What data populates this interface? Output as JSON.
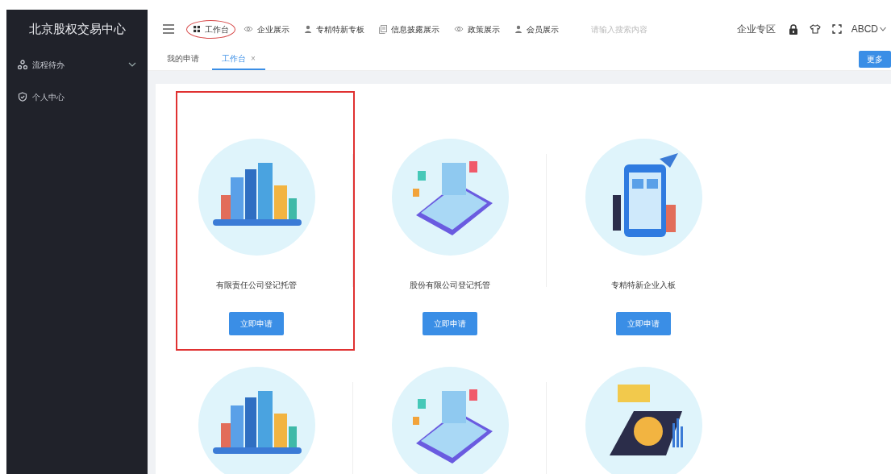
{
  "sidebar": {
    "title": "北京股权交易中心",
    "items": [
      {
        "label": "流程待办",
        "expanded": false
      },
      {
        "label": "个人中心"
      }
    ]
  },
  "top_nav": {
    "items": [
      {
        "label": "工作台",
        "circled": true
      },
      {
        "label": "企业展示",
        "circled": false
      },
      {
        "label": "专精特新专板",
        "circled": false
      },
      {
        "label": "信息披露展示",
        "circled": false
      },
      {
        "label": "政策展示",
        "circled": false
      },
      {
        "label": "会员展示",
        "circled": false
      }
    ],
    "search": {
      "placeholder": "请输入搜索内容"
    },
    "zone": "企业专区",
    "user": "ABCD"
  },
  "tabs": [
    {
      "label": "我的申请",
      "selected": false
    },
    {
      "label": "工作台",
      "selected": true,
      "close": "×"
    }
  ],
  "more_button": "更多",
  "cards": [
    {
      "title": "有限责任公司登记托管",
      "button": "立即申请",
      "highlighted": true
    },
    {
      "title": "股份有限公司登记托管",
      "button": "立即申请",
      "highlighted": false
    },
    {
      "title": "专精特新企业入板",
      "button": "立即申请",
      "highlighted": false
    },
    {
      "highlighted": false
    },
    {
      "highlighted": false
    },
    {
      "highlighted": false
    }
  ]
}
